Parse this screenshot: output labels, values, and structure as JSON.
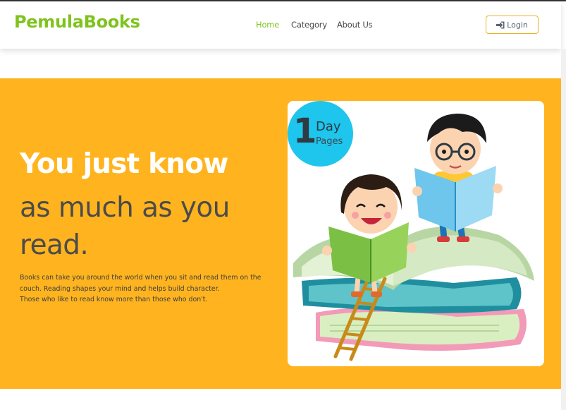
{
  "header": {
    "brand": "PemulaBooks",
    "nav": {
      "home": "Home",
      "category": "Category",
      "about": "About Us"
    },
    "login_label": "Login",
    "accent_color": "#7fc31d",
    "login_border_color": "#e5b426"
  },
  "hero": {
    "background_color": "#ffb41f",
    "title": "You just know",
    "subtitle": "as much as you read.",
    "description_lines": [
      "Books can take you around the world when you sit and read them on the",
      "couch. Reading shapes your mind and helps build character.",
      "Those who like to read know more than those who don't."
    ],
    "badge": {
      "number": "1",
      "word1": "Day",
      "word2": "Pages",
      "color": "#1ec5ec"
    },
    "illustration": "two-children-reading-on-books"
  },
  "icons": {
    "login": "sign-in-icon"
  }
}
